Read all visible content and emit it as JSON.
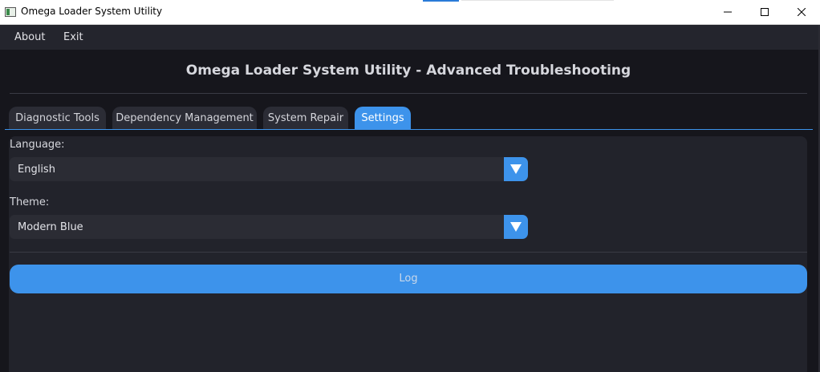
{
  "window": {
    "title": "Omega Loader System Utility",
    "controls": [
      "minimize",
      "maximize",
      "close"
    ]
  },
  "menu": {
    "about_label": "About",
    "exit_label": "Exit"
  },
  "header": {
    "title": "Omega Loader System Utility - Advanced Troubleshooting"
  },
  "tabs": [
    {
      "label": "Diagnostic Tools",
      "active": false
    },
    {
      "label": "Dependency Management",
      "active": false
    },
    {
      "label": "System Repair",
      "active": false
    },
    {
      "label": "Settings",
      "active": true
    }
  ],
  "settings": {
    "language": {
      "label": "Language:",
      "value": "English"
    },
    "theme": {
      "label": "Theme:",
      "value": "Modern Blue"
    }
  },
  "log": {
    "label": "Log"
  },
  "colors": {
    "accent": "#3d93eb",
    "background": "#16161c",
    "panel": "#22232b",
    "menubar": "#24252d"
  },
  "icons": {
    "app": "app-icon",
    "minimize": "minimize-icon",
    "maximize": "maximize-icon",
    "close": "close-icon",
    "dropdown": "chevron-down-icon"
  }
}
